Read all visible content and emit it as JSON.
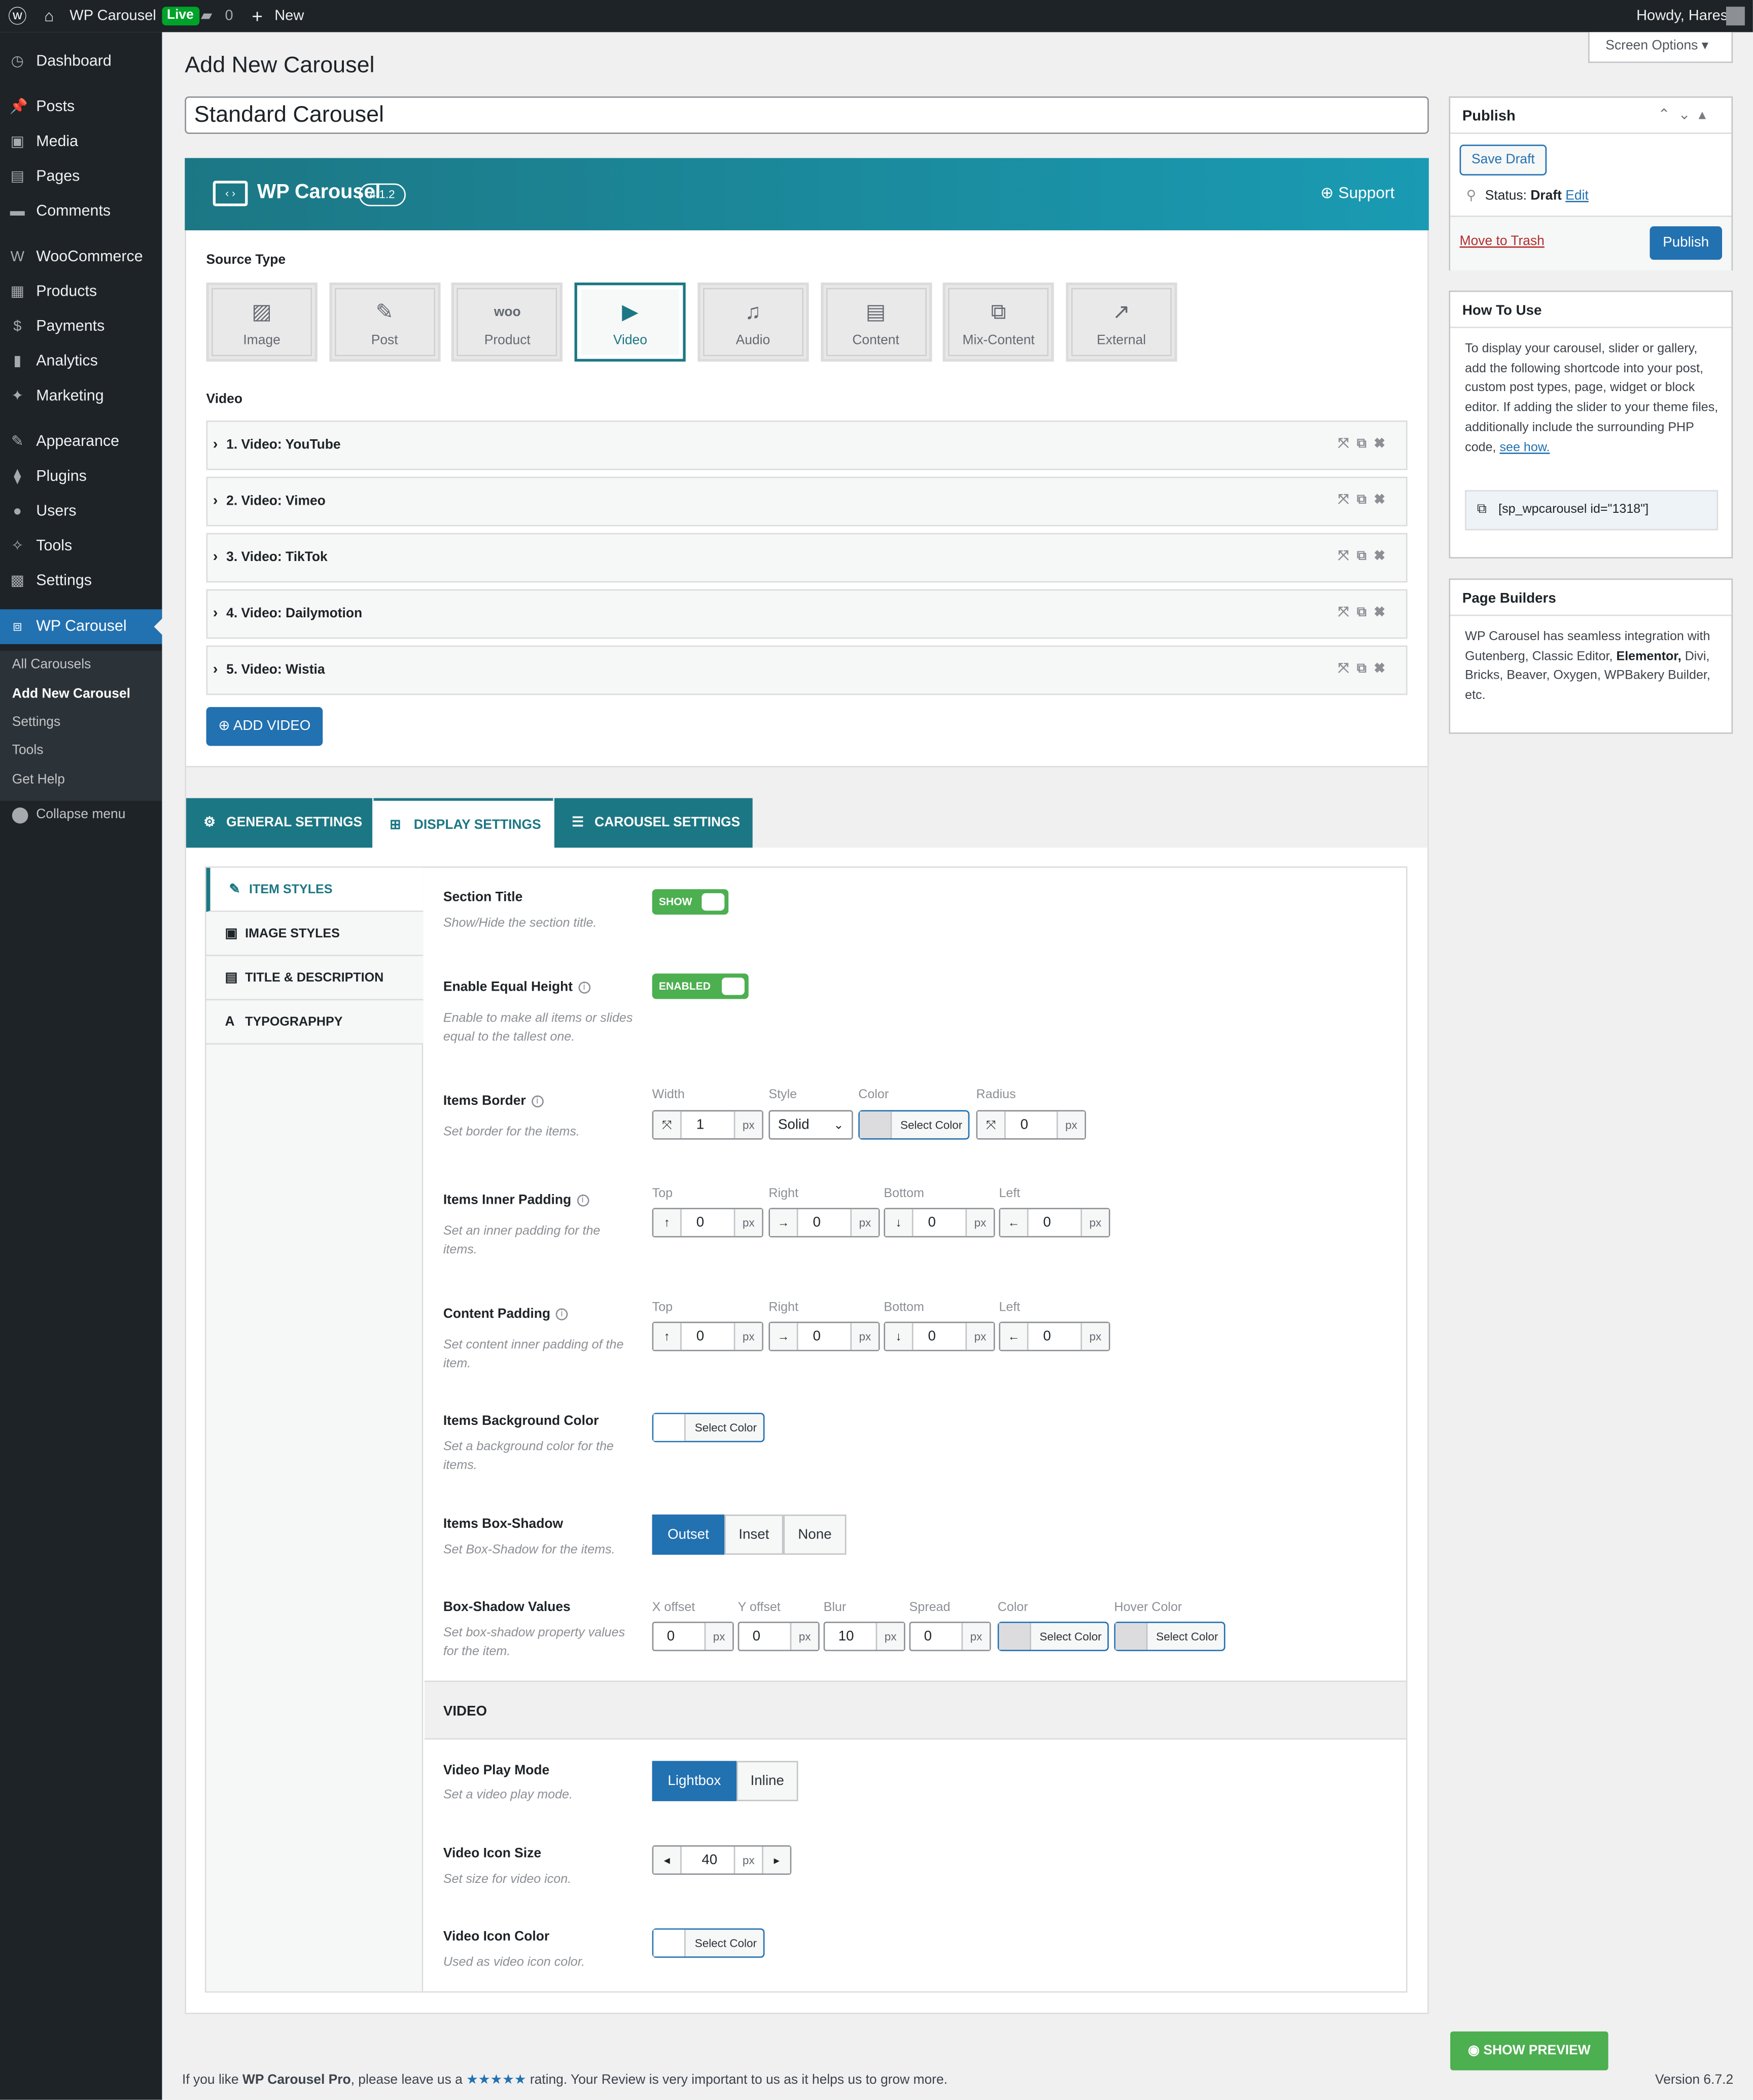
{
  "admin_bar": {
    "site_name": "WP Carousel",
    "live_badge": "Live",
    "comments_count": "0",
    "new_label": "New",
    "howdy": "Howdy, Hares"
  },
  "sidebar": {
    "items": [
      {
        "label": "Dashboard",
        "icon": "dashboard-icon"
      },
      {
        "label": "Posts",
        "icon": "pin-icon"
      },
      {
        "label": "Media",
        "icon": "media-icon"
      },
      {
        "label": "Pages",
        "icon": "pages-icon"
      },
      {
        "label": "Comments",
        "icon": "comment-icon"
      },
      {
        "label": "WooCommerce",
        "icon": "woo-icon"
      },
      {
        "label": "Products",
        "icon": "archive-icon"
      },
      {
        "label": "Payments",
        "icon": "dollar-icon"
      },
      {
        "label": "Analytics",
        "icon": "chart-icon"
      },
      {
        "label": "Marketing",
        "icon": "megaphone-icon"
      },
      {
        "label": "Appearance",
        "icon": "brush-icon"
      },
      {
        "label": "Plugins",
        "icon": "plug-icon"
      },
      {
        "label": "Users",
        "icon": "user-icon"
      },
      {
        "label": "Tools",
        "icon": "wrench-icon"
      },
      {
        "label": "Settings",
        "icon": "settings-icon"
      },
      {
        "label": "WP Carousel",
        "icon": "carousel-icon"
      }
    ],
    "submenu": [
      "All Carousels",
      "Add New Carousel",
      "Settings",
      "Tools",
      "Get Help"
    ],
    "collapse": "Collapse menu"
  },
  "page": {
    "title": "Add New Carousel",
    "screen_options": "Screen Options",
    "post_title_value": "Standard Carousel"
  },
  "plugin": {
    "brand": "WP Carousel",
    "version": "4.1.2",
    "support": "Support"
  },
  "source": {
    "label": "Source Type",
    "types": [
      "Image",
      "Post",
      "Product",
      "Video",
      "Audio",
      "Content",
      "Mix-Content",
      "External"
    ],
    "selected": "Video"
  },
  "video": {
    "label": "Video",
    "items": [
      "1.  Video:  YouTube",
      "2.  Video:  Vimeo",
      "3.  Video:  TikTok",
      "4.  Video:  Dailymotion",
      "5.  Video:  Wistia"
    ],
    "add_button": "ADD VIDEO"
  },
  "tabs": [
    "GENERAL SETTINGS",
    "DISPLAY SETTINGS",
    "CAROUSEL SETTINGS"
  ],
  "subtabs": [
    "ITEM STYLES",
    "IMAGE STYLES",
    "TITLE & DESCRIPTION",
    "TYPOGRAPHPY"
  ],
  "fields": {
    "section_title": {
      "title": "Section Title",
      "desc": "Show/Hide the section title.",
      "toggle": "SHOW"
    },
    "equal_height": {
      "title": "Enable Equal Height",
      "desc": "Enable to make all items or slides equal to the tallest one.",
      "toggle": "ENABLED"
    },
    "border": {
      "title": "Items Border",
      "desc": "Set border for the items.",
      "labels": [
        "Width",
        "Style",
        "Color",
        "Radius"
      ],
      "width": "1",
      "style": "Solid",
      "radius": "0",
      "unit": "px",
      "select_color": "Select Color"
    },
    "inner_padding": {
      "title": "Items Inner Padding",
      "desc": "Set an inner padding for the items.",
      "labels": [
        "Top",
        "Right",
        "Bottom",
        "Left"
      ],
      "values": [
        "0",
        "0",
        "0",
        "0"
      ]
    },
    "content_padding": {
      "title": "Content Padding",
      "desc": "Set content inner padding of the item.",
      "labels": [
        "Top",
        "Right",
        "Bottom",
        "Left"
      ],
      "values": [
        "0",
        "0",
        "0",
        "0"
      ]
    },
    "bg_color": {
      "title": "Items Background Color",
      "desc": "Set a background color for the items.",
      "button": "Select Color"
    },
    "box_shadow": {
      "title": "Items Box-Shadow",
      "desc": "Set Box-Shadow for the items.",
      "options": [
        "Outset",
        "Inset",
        "None"
      ],
      "selected": "Outset"
    },
    "shadow_values": {
      "title": "Box-Shadow Values",
      "desc": "Set box-shadow property values for the item.",
      "labels": [
        "X offset",
        "Y offset",
        "Blur",
        "Spread",
        "Color",
        "Hover Color"
      ],
      "values": [
        "0",
        "0",
        "10",
        "0"
      ]
    },
    "video_section": "VIDEO",
    "play_mode": {
      "title": "Video Play Mode",
      "desc": "Set a video play mode.",
      "options": [
        "Lightbox",
        "Inline"
      ],
      "selected": "Lightbox"
    },
    "icon_size": {
      "title": "Video Icon Size",
      "desc": "Set size for video icon.",
      "value": "40"
    },
    "icon_color": {
      "title": "Video Icon Color",
      "desc": "Used as video icon color.",
      "button": "Select Color"
    }
  },
  "publish": {
    "title": "Publish",
    "save_draft": "Save Draft",
    "status_label": "Status:",
    "status_value": "Draft",
    "edit": "Edit",
    "trash": "Move to Trash",
    "publish_button": "Publish"
  },
  "how_to_use": {
    "title": "How To Use",
    "text": "To display your carousel, slider or gallery, add the following shortcode into your post, custom post types, page, widget or block editor. If adding the slider to your theme files, additionally include the surrounding PHP code,",
    "link": "see how.",
    "shortcode": "[sp_wpcarousel id=\"1318\"]"
  },
  "page_builders": {
    "title": "Page Builders",
    "text_before": "WP Carousel has seamless integration with Gutenberg, Classic Editor,",
    "bold": "Elementor,",
    "text_after": "Divi, Bricks, Beaver, Oxygen, WPBakery Builder, etc."
  },
  "preview_button": "SHOW PREVIEW",
  "footer": {
    "prefix": "If you like",
    "plugin": "WP Carousel Pro",
    "mid": ", please leave us a",
    "stars": "★★★★★",
    "suffix": "rating. Your Review is very important to us as it helps us to grow more.",
    "version": "Version 6.7.2"
  },
  "colors": {
    "accent": "#1c7784",
    "wp_blue": "#2271b1",
    "green": "#4caf50"
  }
}
